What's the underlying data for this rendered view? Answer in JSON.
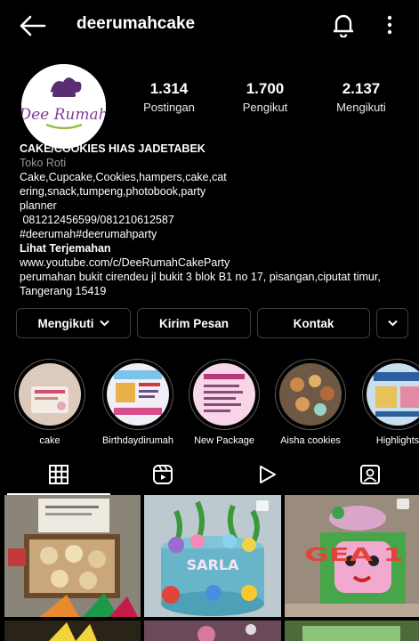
{
  "header": {
    "username": "deerumahcake"
  },
  "icons": {
    "back": "arrow-left-icon",
    "notifications": "bell-icon",
    "more": "vertical-dots-icon"
  },
  "avatar": {
    "logo_text": "Dee Rumah"
  },
  "stats": [
    {
      "value": "1.314",
      "label": "Postingan"
    },
    {
      "value": "1.700",
      "label": "Pengikut"
    },
    {
      "value": "2.137",
      "label": "Mengikuti"
    }
  ],
  "bio": {
    "name": "CAKE/COOKIES HIAS JADETABEK",
    "category": "Toko Roti",
    "lines": [
      "Cake,Cupcake,Cookies,hampers,cake,cat",
      "ering,snack,tumpeng,photobook,party",
      "planner",
      " 081212456599/081210612587",
      "#deerumah#deerumahparty"
    ],
    "translate": "Lihat Terjemahan",
    "link": "www.youtube.com/c/DeeRumahCakeParty",
    "address_lines": [
      "perumahan bukit cirendeu jl bukit 3 blok B1 no 17, pisangan,ciputat timur,",
      "Tangerang 15419"
    ]
  },
  "actions": {
    "following": "Mengikuti",
    "message": "Kirim Pesan",
    "contact": "Kontak"
  },
  "highlights": [
    {
      "label": "cake",
      "color": "#d9c7b8"
    },
    {
      "label": "Birthdaydirumah",
      "color": "#f2eef6"
    },
    {
      "label": "New Package",
      "color": "#f7d9ea"
    },
    {
      "label": "Aisha cookies",
      "color": "#6e5a44"
    },
    {
      "label": "Highlights",
      "color": "#c9dfee"
    }
  ],
  "tabs": [
    "grid-icon",
    "reels-icon",
    "video-play-icon",
    "tagged-icon"
  ],
  "posts": [
    {
      "label": "cookies box",
      "color": "#8a6a48"
    },
    {
      "label": "SARLA",
      "color": "#6bb9cf"
    },
    {
      "label": "GEA 1",
      "color": "#49a84b"
    }
  ]
}
